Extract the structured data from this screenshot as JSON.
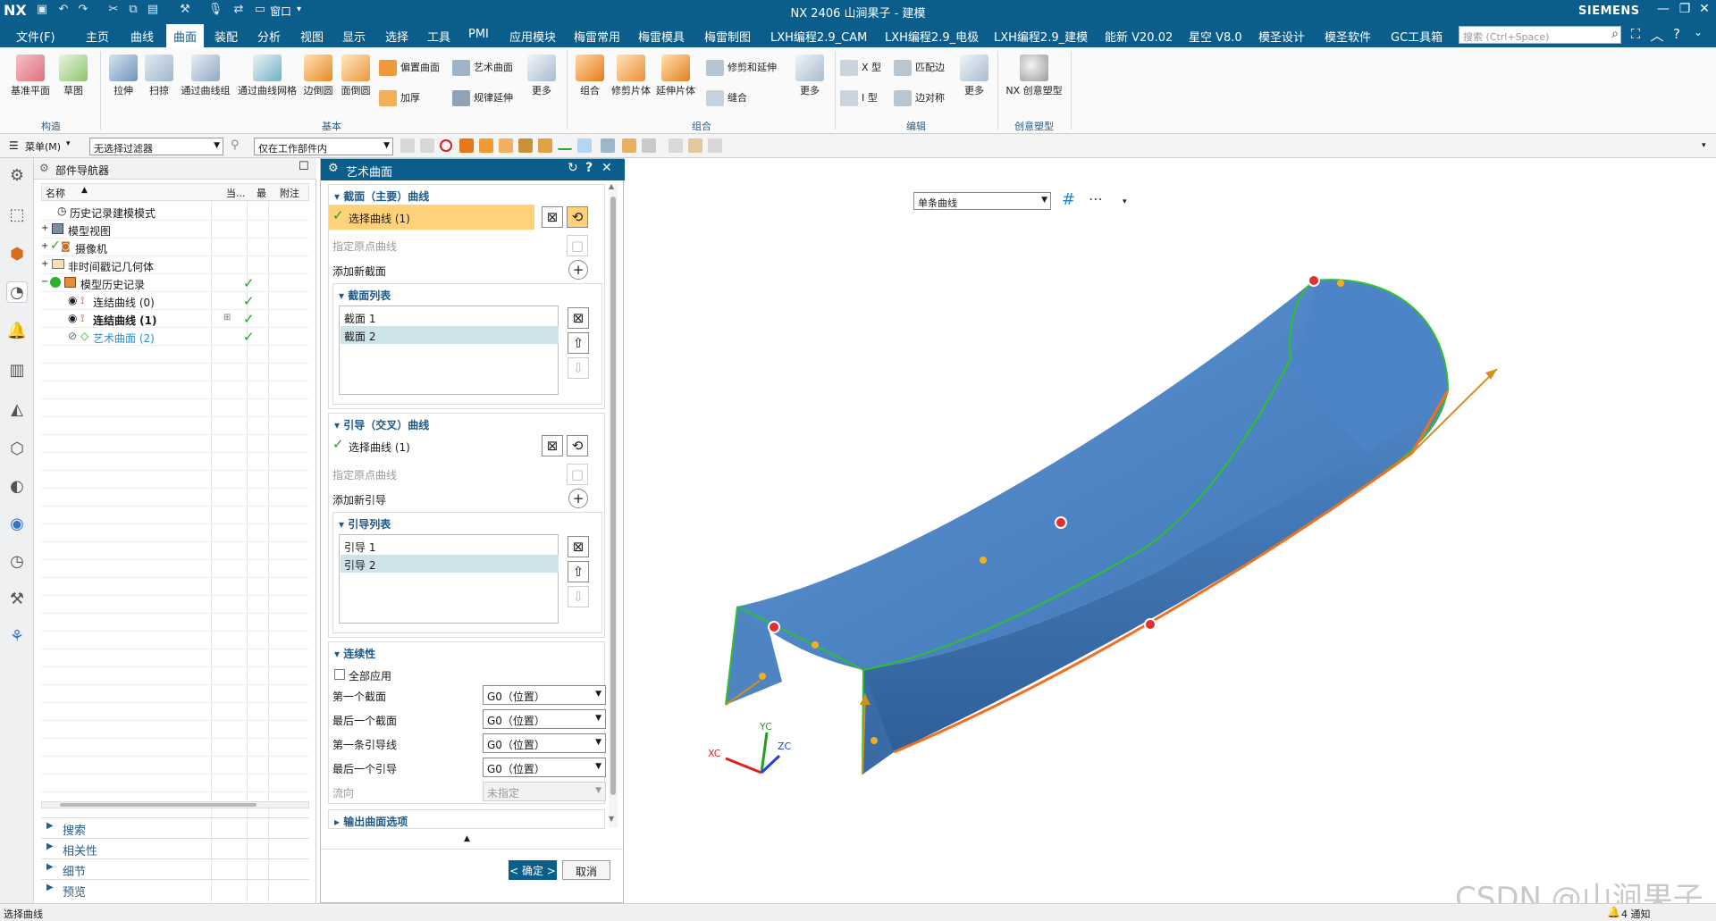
{
  "app": {
    "logo": "NX",
    "title": "NX 2406 山涧果子 - 建模",
    "brand": "SIEMENS",
    "window_menu": "窗口",
    "accent": "#0b5e8c"
  },
  "menu": {
    "tabs": [
      "文件(F)",
      "主页",
      "曲线",
      "曲面",
      "装配",
      "分析",
      "视图",
      "显示",
      "选择",
      "工具",
      "PMI",
      "应用模块",
      "梅雷常用",
      "梅雷模具",
      "梅雷制图",
      "LXH编程2.9_CAM",
      "LXH编程2.9_电极",
      "LXH编程2.9_建模",
      "能新 V20.02",
      "星空 V8.0",
      "模圣设计",
      "模圣软件",
      "GC工具箱"
    ],
    "active_tab": "曲面",
    "search_placeholder": "搜索 (Ctrl+Space)"
  },
  "ribbon": {
    "construct": {
      "items": [
        "基准平面",
        "草图"
      ],
      "label": "构造"
    },
    "basic": {
      "items": [
        "拉伸",
        "扫掠",
        "通过曲线组",
        "通过曲线网格",
        "边倒圆",
        "面倒圆"
      ],
      "small": [
        "偏置曲面",
        "艺术曲面",
        "加厚",
        "规律延伸"
      ],
      "more": "更多",
      "label": "基本"
    },
    "combine": {
      "items": [
        "组合",
        "修剪片体",
        "延伸片体"
      ],
      "small": [
        "修剪和延伸",
        "缝合"
      ],
      "more": "更多",
      "label": "组合"
    },
    "edit": {
      "small": [
        "X 型",
        "匹配边",
        "I 型",
        "边对称"
      ],
      "more": "更多",
      "label": "编辑"
    },
    "creative": {
      "items": [
        "NX 创意塑型"
      ],
      "label": "创意塑型"
    }
  },
  "toolbar2": {
    "menu_label": "菜单(M)",
    "filter": "无选择过滤器",
    "scope": "仅在工作部件内"
  },
  "navigator": {
    "title": "部件导航器",
    "columns": [
      "名称",
      "当...",
      "最",
      "附注"
    ],
    "rows": [
      {
        "label": "历史记录建模模式",
        "indent": 1,
        "check": false,
        "bold": false
      },
      {
        "label": "模型视图",
        "indent": 0,
        "check": false,
        "bold": false
      },
      {
        "label": "摄像机",
        "indent": 0,
        "check": false,
        "bold": false
      },
      {
        "label": "非时间戳记几何体",
        "indent": 0,
        "check": false,
        "bold": false
      },
      {
        "label": "模型历史记录",
        "indent": 0,
        "check": true,
        "bold": false
      },
      {
        "label": "连结曲线 (0)",
        "indent": 2,
        "check": true,
        "bold": false
      },
      {
        "label": "连结曲线 (1)",
        "indent": 2,
        "check": true,
        "bold": true
      },
      {
        "label": "艺术曲面 (2)",
        "indent": 2,
        "check": true,
        "bold": false
      }
    ],
    "sections": [
      "搜索",
      "相关性",
      "细节",
      "预览"
    ]
  },
  "dialog": {
    "title": "艺术曲面",
    "section_curves": {
      "title": "截面（主要）曲线",
      "select": "选择曲线 (1)",
      "origin": "指定原点曲线",
      "add": "添加新截面",
      "list_title": "截面列表",
      "list": [
        "截面 1",
        "截面 2"
      ]
    },
    "guide_curves": {
      "title": "引导（交叉）曲线",
      "select": "选择曲线 (1)",
      "origin": "指定原点曲线",
      "add": "添加新引导",
      "list_title": "引导列表",
      "list": [
        "引导 1",
        "引导 2"
      ]
    },
    "continuity": {
      "title": "连续性",
      "apply_all": "全部应用",
      "fields": [
        {
          "label": "第一个截面",
          "value": "G0（位置）"
        },
        {
          "label": "最后一个截面",
          "value": "G0（位置）"
        },
        {
          "label": "第一条引导线",
          "value": "G0（位置）"
        },
        {
          "label": "最后一个引导",
          "value": "G0（位置）"
        },
        {
          "label": "流向",
          "value": "未指定"
        }
      ]
    },
    "output_title": "输出曲面选项",
    "ok": "< 确定 >",
    "cancel": "取消"
  },
  "viewport": {
    "curve_rule": "单条曲线",
    "axes": [
      "YC",
      "XC",
      "ZC"
    ],
    "surface_color": "#5b8fcc",
    "edge_color": "#2ec02e",
    "guide_color": "#f07020"
  },
  "status": {
    "message": "选择曲线",
    "notifications": "4 通知"
  },
  "watermark": "CSDN @山涧果子"
}
